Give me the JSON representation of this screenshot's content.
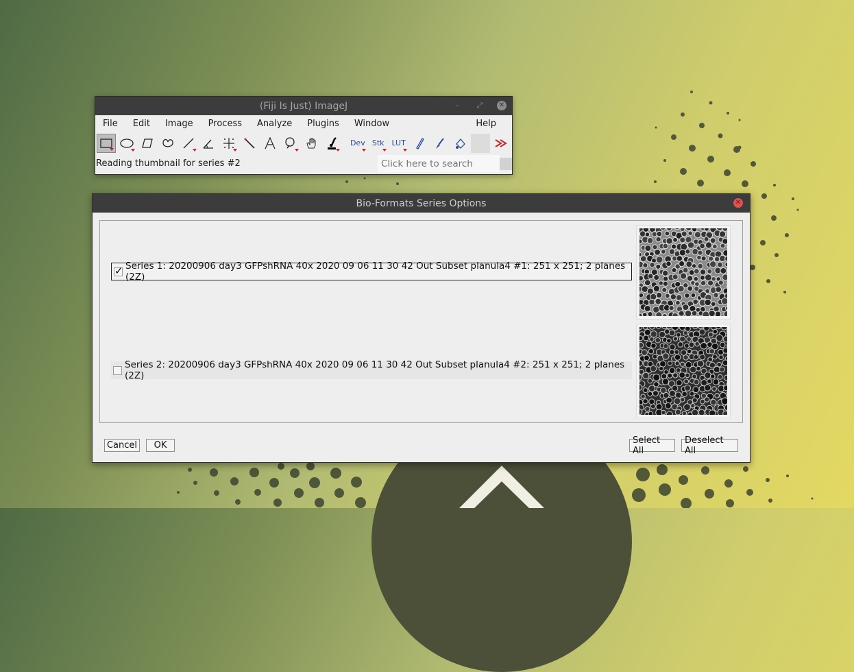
{
  "imagej_window": {
    "title": "(Fiji Is Just) ImageJ",
    "menus": [
      "File",
      "Edit",
      "Image",
      "Process",
      "Analyze",
      "Plugins",
      "Window"
    ],
    "help_menu": "Help",
    "tools": {
      "dev": "Dev",
      "stk": "Stk",
      "lut": "LUT"
    },
    "status_text": "Reading thumbnail for series #2",
    "search_placeholder": "Click here to search"
  },
  "dialog": {
    "title": "Bio-Formats Series Options",
    "series": [
      {
        "label": "Series 1: 20200906 day3 GFPshRNA 40x 2020 09 06  11 30 42 Out Subset planula4 #1: 251 x 251; 2 planes (2Z)",
        "checked": true
      },
      {
        "label": "Series 2: 20200906 day3 GFPshRNA 40x 2020 09 06  11 30 42 Out Subset planula4 #2: 251 x 251; 2 planes (2Z)",
        "checked": false
      }
    ],
    "buttons": {
      "cancel": "Cancel",
      "ok": "OK",
      "select_all": "Select All",
      "deselect_all": "Deselect All"
    }
  },
  "colors": {
    "titlebar": "#3c3c3c",
    "window_bg": "#eeeeee",
    "close_red": "#d9534f",
    "tool_blue": "#2a4c9a",
    "arrow_red": "#c0272d"
  }
}
